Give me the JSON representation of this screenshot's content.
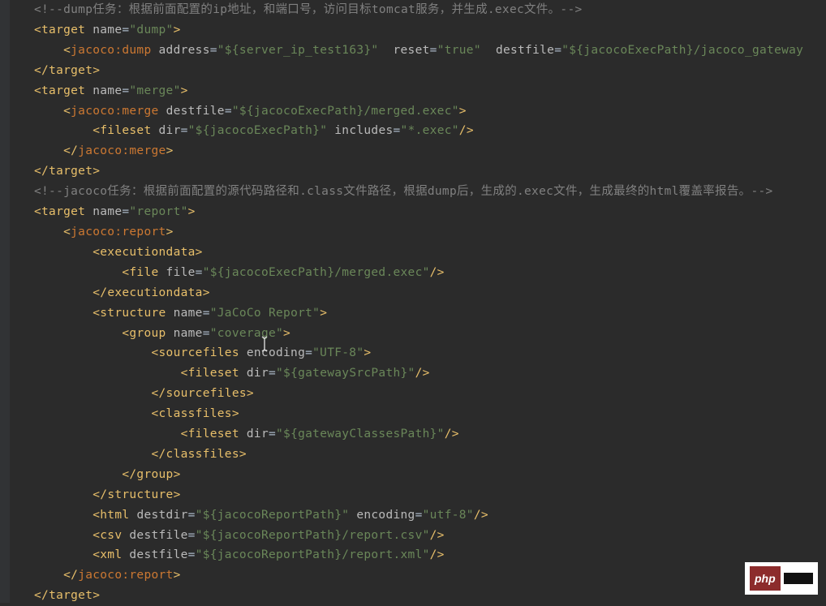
{
  "badge": {
    "text": "php"
  },
  "lines": [
    [
      {
        "c": "cmt",
        "t": "<!--dump任务：根据前面配置的ip地址，和端口号，访问目标tomcat服务，并生成.exec文件。-->"
      }
    ],
    [
      {
        "c": "pkt",
        "t": "<"
      },
      {
        "c": "tagname",
        "t": "target"
      },
      {
        "c": "",
        "t": " "
      },
      {
        "c": "attr",
        "t": "name"
      },
      {
        "c": "eq",
        "t": "="
      },
      {
        "c": "str",
        "t": "\"dump\""
      },
      {
        "c": "pkt",
        "t": ">"
      }
    ],
    [
      {
        "c": "",
        "t": "    "
      },
      {
        "c": "pkt",
        "t": "<"
      },
      {
        "c": "ns",
        "t": "jacoco"
      },
      {
        "c": "ns",
        "t": ":"
      },
      {
        "c": "ns",
        "t": "dump"
      },
      {
        "c": "",
        "t": " "
      },
      {
        "c": "attr",
        "t": "address"
      },
      {
        "c": "eq",
        "t": "="
      },
      {
        "c": "str",
        "t": "\"${server_ip_test163}\""
      },
      {
        "c": "",
        "t": "  "
      },
      {
        "c": "attr",
        "t": "reset"
      },
      {
        "c": "eq",
        "t": "="
      },
      {
        "c": "str",
        "t": "\"true\""
      },
      {
        "c": "",
        "t": "  "
      },
      {
        "c": "attr",
        "t": "destfile"
      },
      {
        "c": "eq",
        "t": "="
      },
      {
        "c": "str",
        "t": "\"${jacocoExecPath}/jacoco_gateway"
      }
    ],
    [
      {
        "c": "pkt",
        "t": "</"
      },
      {
        "c": "tagname",
        "t": "target"
      },
      {
        "c": "pkt",
        "t": ">"
      }
    ],
    [
      {
        "c": "pkt",
        "t": "<"
      },
      {
        "c": "tagname",
        "t": "target"
      },
      {
        "c": "",
        "t": " "
      },
      {
        "c": "attr",
        "t": "name"
      },
      {
        "c": "eq",
        "t": "="
      },
      {
        "c": "str",
        "t": "\"merge\""
      },
      {
        "c": "pkt",
        "t": ">"
      }
    ],
    [
      {
        "c": "",
        "t": "    "
      },
      {
        "c": "pkt",
        "t": "<"
      },
      {
        "c": "ns",
        "t": "jacoco"
      },
      {
        "c": "ns",
        "t": ":"
      },
      {
        "c": "ns",
        "t": "merge"
      },
      {
        "c": "",
        "t": " "
      },
      {
        "c": "attr",
        "t": "destfile"
      },
      {
        "c": "eq",
        "t": "="
      },
      {
        "c": "str",
        "t": "\"${jacocoExecPath}/merged.exec\""
      },
      {
        "c": "pkt",
        "t": ">"
      }
    ],
    [
      {
        "c": "",
        "t": "        "
      },
      {
        "c": "pkt",
        "t": "<"
      },
      {
        "c": "tagname",
        "t": "fileset"
      },
      {
        "c": "",
        "t": " "
      },
      {
        "c": "attr",
        "t": "dir"
      },
      {
        "c": "eq",
        "t": "="
      },
      {
        "c": "str",
        "t": "\"${jacocoExecPath}\""
      },
      {
        "c": "",
        "t": " "
      },
      {
        "c": "attr",
        "t": "includes"
      },
      {
        "c": "eq",
        "t": "="
      },
      {
        "c": "str",
        "t": "\"*.exec\""
      },
      {
        "c": "pkt",
        "t": "/>"
      }
    ],
    [
      {
        "c": "",
        "t": "    "
      },
      {
        "c": "pkt",
        "t": "</"
      },
      {
        "c": "ns",
        "t": "jacoco"
      },
      {
        "c": "ns",
        "t": ":"
      },
      {
        "c": "ns",
        "t": "merge"
      },
      {
        "c": "pkt",
        "t": ">"
      }
    ],
    [
      {
        "c": "pkt",
        "t": "</"
      },
      {
        "c": "tagname",
        "t": "target"
      },
      {
        "c": "pkt",
        "t": ">"
      }
    ],
    [
      {
        "c": "cmt",
        "t": "<!--jacoco任务：根据前面配置的源代码路径和.class文件路径，根据dump后，生成的.exec文件，生成最终的html覆盖率报告。-->"
      }
    ],
    [
      {
        "c": "pkt",
        "t": "<"
      },
      {
        "c": "tagname",
        "t": "target"
      },
      {
        "c": "",
        "t": " "
      },
      {
        "c": "attr",
        "t": "name"
      },
      {
        "c": "eq",
        "t": "="
      },
      {
        "c": "str",
        "t": "\"report\""
      },
      {
        "c": "pkt",
        "t": ">"
      }
    ],
    [
      {
        "c": "",
        "t": "    "
      },
      {
        "c": "pkt",
        "t": "<"
      },
      {
        "c": "ns",
        "t": "jacoco"
      },
      {
        "c": "ns",
        "t": ":"
      },
      {
        "c": "ns",
        "t": "report"
      },
      {
        "c": "pkt",
        "t": ">"
      }
    ],
    [
      {
        "c": "",
        "t": "        "
      },
      {
        "c": "pkt",
        "t": "<"
      },
      {
        "c": "tagname",
        "t": "executiondata"
      },
      {
        "c": "pkt",
        "t": ">"
      }
    ],
    [
      {
        "c": "",
        "t": "            "
      },
      {
        "c": "pkt",
        "t": "<"
      },
      {
        "c": "tagname",
        "t": "file"
      },
      {
        "c": "",
        "t": " "
      },
      {
        "c": "attr",
        "t": "file"
      },
      {
        "c": "eq",
        "t": "="
      },
      {
        "c": "str",
        "t": "\"${jacocoExecPath}/merged.exec\""
      },
      {
        "c": "pkt",
        "t": "/>"
      }
    ],
    [
      {
        "c": "",
        "t": "        "
      },
      {
        "c": "pkt",
        "t": "</"
      },
      {
        "c": "tagname",
        "t": "executiondata"
      },
      {
        "c": "pkt",
        "t": ">"
      }
    ],
    [
      {
        "c": "",
        "t": "        "
      },
      {
        "c": "pkt",
        "t": "<"
      },
      {
        "c": "tagname",
        "t": "structure"
      },
      {
        "c": "",
        "t": " "
      },
      {
        "c": "attr",
        "t": "name"
      },
      {
        "c": "eq",
        "t": "="
      },
      {
        "c": "str",
        "t": "\"JaCoCo Report\""
      },
      {
        "c": "pkt",
        "t": ">"
      }
    ],
    [
      {
        "c": "",
        "t": "            "
      },
      {
        "c": "pkt",
        "t": "<"
      },
      {
        "c": "tagname",
        "t": "group"
      },
      {
        "c": "",
        "t": " "
      },
      {
        "c": "attr",
        "t": "name"
      },
      {
        "c": "eq",
        "t": "="
      },
      {
        "c": "str",
        "t": "\"coverage\""
      },
      {
        "c": "pkt",
        "t": ">"
      }
    ],
    [
      {
        "c": "",
        "t": "                "
      },
      {
        "c": "pkt",
        "t": "<"
      },
      {
        "c": "tagname",
        "t": "sourcefiles"
      },
      {
        "c": "",
        "t": " "
      },
      {
        "c": "attr",
        "t": "encoding"
      },
      {
        "c": "eq",
        "t": "="
      },
      {
        "c": "str",
        "t": "\"UTF-8\""
      },
      {
        "c": "pkt",
        "t": ">"
      }
    ],
    [
      {
        "c": "",
        "t": "                    "
      },
      {
        "c": "pkt",
        "t": "<"
      },
      {
        "c": "tagname",
        "t": "fileset"
      },
      {
        "c": "",
        "t": " "
      },
      {
        "c": "attr",
        "t": "dir"
      },
      {
        "c": "eq",
        "t": "="
      },
      {
        "c": "str",
        "t": "\"${gatewaySrcPath}\""
      },
      {
        "c": "pkt",
        "t": "/>"
      }
    ],
    [
      {
        "c": "",
        "t": "                "
      },
      {
        "c": "pkt",
        "t": "</"
      },
      {
        "c": "tagname",
        "t": "sourcefiles"
      },
      {
        "c": "pkt",
        "t": ">"
      }
    ],
    [
      {
        "c": "",
        "t": "                "
      },
      {
        "c": "pkt",
        "t": "<"
      },
      {
        "c": "tagname",
        "t": "classfiles"
      },
      {
        "c": "pkt",
        "t": ">"
      }
    ],
    [
      {
        "c": "",
        "t": "                    "
      },
      {
        "c": "pkt",
        "t": "<"
      },
      {
        "c": "tagname",
        "t": "fileset"
      },
      {
        "c": "",
        "t": " "
      },
      {
        "c": "attr",
        "t": "dir"
      },
      {
        "c": "eq",
        "t": "="
      },
      {
        "c": "str",
        "t": "\"${gatewayClassesPath}\""
      },
      {
        "c": "pkt",
        "t": "/>"
      }
    ],
    [
      {
        "c": "",
        "t": "                "
      },
      {
        "c": "pkt",
        "t": "</"
      },
      {
        "c": "tagname",
        "t": "classfiles"
      },
      {
        "c": "pkt",
        "t": ">"
      }
    ],
    [
      {
        "c": "",
        "t": "            "
      },
      {
        "c": "pkt",
        "t": "</"
      },
      {
        "c": "tagname",
        "t": "group"
      },
      {
        "c": "pkt",
        "t": ">"
      }
    ],
    [
      {
        "c": "",
        "t": "        "
      },
      {
        "c": "pkt",
        "t": "</"
      },
      {
        "c": "tagname",
        "t": "structure"
      },
      {
        "c": "pkt",
        "t": ">"
      }
    ],
    [
      {
        "c": "",
        "t": "        "
      },
      {
        "c": "pkt",
        "t": "<"
      },
      {
        "c": "tagname",
        "t": "html"
      },
      {
        "c": "",
        "t": " "
      },
      {
        "c": "attr",
        "t": "destdir"
      },
      {
        "c": "eq",
        "t": "="
      },
      {
        "c": "str",
        "t": "\"${jacocoReportPath}\""
      },
      {
        "c": "",
        "t": " "
      },
      {
        "c": "attr",
        "t": "encoding"
      },
      {
        "c": "eq",
        "t": "="
      },
      {
        "c": "str",
        "t": "\"utf-8\""
      },
      {
        "c": "pkt",
        "t": "/>"
      }
    ],
    [
      {
        "c": "",
        "t": "        "
      },
      {
        "c": "pkt",
        "t": "<"
      },
      {
        "c": "tagname",
        "t": "csv"
      },
      {
        "c": "",
        "t": " "
      },
      {
        "c": "attr",
        "t": "destfile"
      },
      {
        "c": "eq",
        "t": "="
      },
      {
        "c": "str",
        "t": "\"${jacocoReportPath}/report.csv\""
      },
      {
        "c": "pkt",
        "t": "/>"
      }
    ],
    [
      {
        "c": "",
        "t": "        "
      },
      {
        "c": "pkt",
        "t": "<"
      },
      {
        "c": "tagname",
        "t": "xml"
      },
      {
        "c": "",
        "t": " "
      },
      {
        "c": "attr",
        "t": "destfile"
      },
      {
        "c": "eq",
        "t": "="
      },
      {
        "c": "str",
        "t": "\"${jacocoReportPath}/report.xml\""
      },
      {
        "c": "pkt",
        "t": "/>"
      }
    ],
    [
      {
        "c": "",
        "t": "    "
      },
      {
        "c": "pkt",
        "t": "</"
      },
      {
        "c": "ns",
        "t": "jacoco"
      },
      {
        "c": "ns",
        "t": ":"
      },
      {
        "c": "ns",
        "t": "report"
      },
      {
        "c": "pkt",
        "t": ">"
      }
    ],
    [
      {
        "c": "pkt",
        "t": "</"
      },
      {
        "c": "tagname",
        "t": "target"
      },
      {
        "c": "pkt",
        "t": ">"
      }
    ]
  ]
}
